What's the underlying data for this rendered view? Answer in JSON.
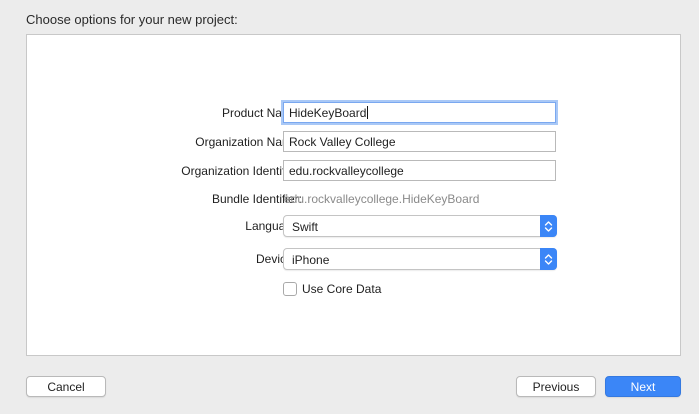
{
  "header": {
    "title": "Choose options for your new project:"
  },
  "form": {
    "product_name": {
      "label": "Product Name:",
      "value": "HideKeyBoard"
    },
    "organization_name": {
      "label": "Organization Name:",
      "value": "Rock Valley College"
    },
    "organization_identifier": {
      "label": "Organization Identifier:",
      "value": "edu.rockvalleycollege"
    },
    "bundle_identifier": {
      "label": "Bundle Identifier:",
      "value": "edu.rockvalleycollege.HideKeyBoard"
    },
    "language": {
      "label": "Language:",
      "selected": "Swift"
    },
    "devices": {
      "label": "Devices:",
      "selected": "iPhone"
    },
    "use_core_data": {
      "label": "Use Core Data",
      "checked": false
    }
  },
  "buttons": {
    "cancel": "Cancel",
    "previous": "Previous",
    "next": "Next"
  },
  "colors": {
    "accent": "#3b86f7",
    "focus_ring": "#a9c8f6"
  }
}
